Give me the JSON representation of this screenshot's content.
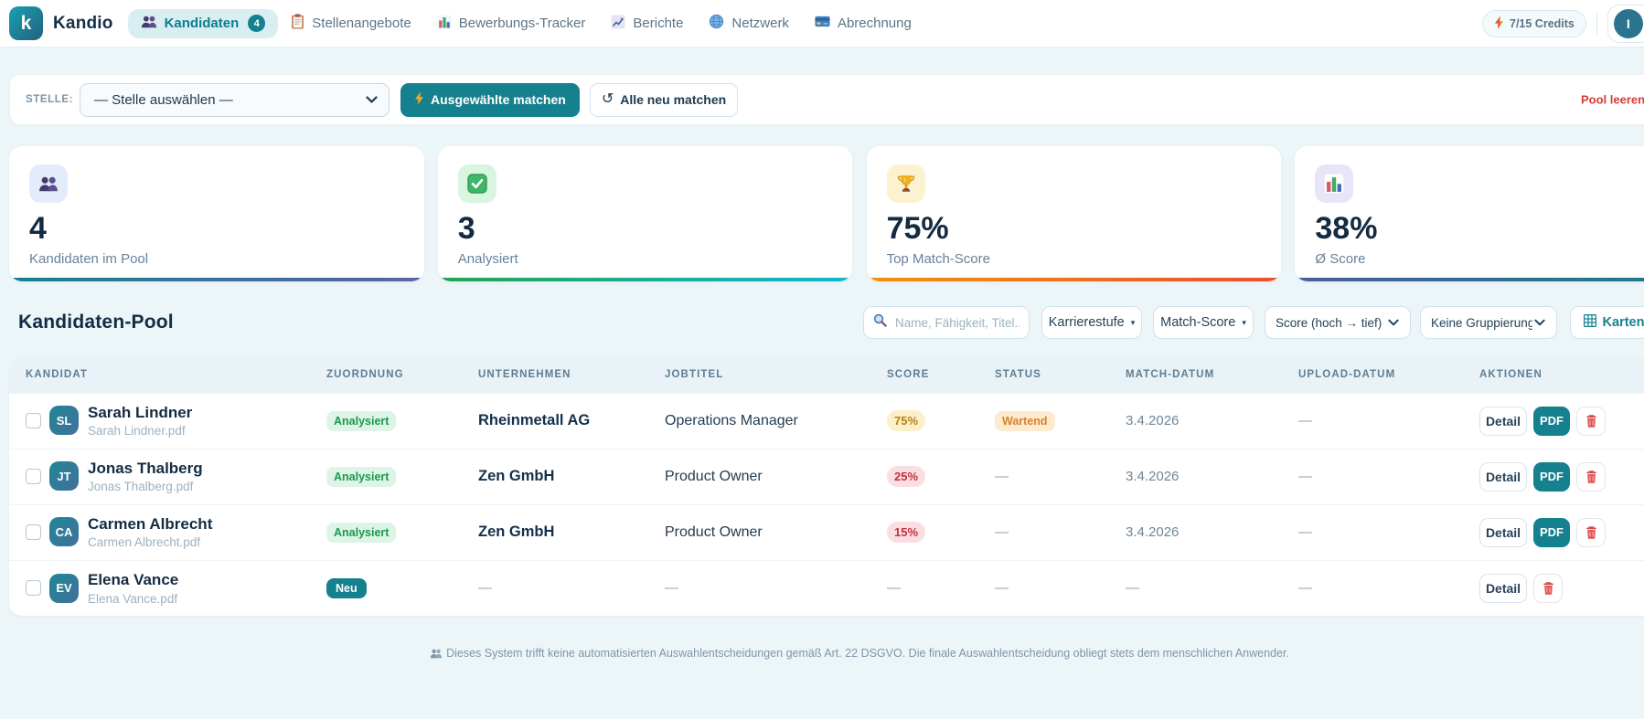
{
  "brand": {
    "logo_letter": "k",
    "name": "Kandio"
  },
  "nav": {
    "items": [
      {
        "label": "Kandidaten",
        "icon": "users-icon",
        "active": true,
        "badge": "4"
      },
      {
        "label": "Stellenangebote",
        "icon": "clipboard-icon",
        "active": false
      },
      {
        "label": "Bewerbungs-Tracker",
        "icon": "bar-chart-icon",
        "active": false
      },
      {
        "label": "Berichte",
        "icon": "chart-up-icon",
        "active": false
      },
      {
        "label": "Netzwerk",
        "icon": "globe-icon",
        "active": false
      },
      {
        "label": "Abrechnung",
        "icon": "credit-card-icon",
        "active": false
      }
    ],
    "credits_label": "7/15 Credits",
    "avatar_initial": "I"
  },
  "toolbar": {
    "stelle_label": "STELLE:",
    "stelle_select_value": "— Stelle auswählen —",
    "match_selected_label": "Ausgewählte matchen",
    "rematch_all_label": "Alle neu matchen",
    "refresh_glyph": "↺",
    "clear_pool_label": "Pool leeren"
  },
  "stats": {
    "cards": [
      {
        "value": "4",
        "label": "Kandidaten im Pool",
        "icon": "users-icon",
        "tile_color": "#e3ecfa",
        "accent_from": "#15808f",
        "accent_to": "#5c63ab"
      },
      {
        "value": "3",
        "label": "Analysiert",
        "icon": "check-icon",
        "tile_color": "#d9f4df",
        "accent_from": "#23a452",
        "accent_to": "#12b5d0"
      },
      {
        "value": "75%",
        "label": "Top Match-Score",
        "icon": "trophy-icon",
        "tile_color": "#fdf2cf",
        "accent_from": "#f0930f",
        "accent_to": "#e94f30"
      },
      {
        "value": "38%",
        "label": "Ø Score",
        "icon": "bar-chart-icon",
        "tile_color": "#e9e5f8",
        "accent_from": "#4b5f9b",
        "accent_to": "#16808f"
      }
    ]
  },
  "pool": {
    "title": "Kandidaten-Pool",
    "search_placeholder": "Name, Fähigkeit, Titel...",
    "filter_karrierestufe": "Karrierestufe",
    "filter_match_score": "Match-Score",
    "sort_select_value": "Score (hoch → tief)",
    "group_select_value": "Keine Gruppierung",
    "view_karten_label": "Karten",
    "caret": "▾"
  },
  "table": {
    "headers": [
      "KANDIDAT",
      "ZUORDNUNG",
      "UNTERNEHMEN",
      "JOBTITEL",
      "SCORE",
      "STATUS",
      "MATCH-DATUM",
      "UPLOAD-DATUM",
      "AKTIONEN"
    ],
    "dash": "—",
    "actions": {
      "detail": "Detail",
      "pdf": "PDF"
    },
    "rows": [
      {
        "initials": "SL",
        "name": "Sarah Lindner",
        "file": "Sarah Lindner.pdf",
        "zuordnung": "Analysiert",
        "company": "Rheinmetall AG",
        "jobtitle": "Operations Manager",
        "score": "75%",
        "status": "Wartend",
        "match_date": "3.4.2026",
        "upload_date": "—"
      },
      {
        "initials": "JT",
        "name": "Jonas Thalberg",
        "file": "Jonas Thalberg.pdf",
        "zuordnung": "Analysiert",
        "company": "Zen GmbH",
        "jobtitle": "Product Owner",
        "score": "25%",
        "status": "—",
        "match_date": "3.4.2026",
        "upload_date": "—"
      },
      {
        "initials": "CA",
        "name": "Carmen Albrecht",
        "file": "Carmen Albrecht.pdf",
        "zuordnung": "Analysiert",
        "company": "Zen GmbH",
        "jobtitle": "Product Owner",
        "score": "15%",
        "status": "—",
        "match_date": "3.4.2026",
        "upload_date": "—"
      },
      {
        "initials": "EV",
        "name": "Elena Vance",
        "file": "Elena Vance.pdf",
        "zuordnung": "Neu",
        "company": "—",
        "jobtitle": "—",
        "score": "—",
        "status": "—",
        "match_date": "—",
        "upload_date": "—"
      }
    ]
  },
  "footer": {
    "disclaimer": "Dieses System trifft keine automatisierten Auswahlentscheidungen gemäß Art. 22 DSGVO. Die finale Auswahlentscheidung obliegt stets dem menschlichen Anwender."
  }
}
